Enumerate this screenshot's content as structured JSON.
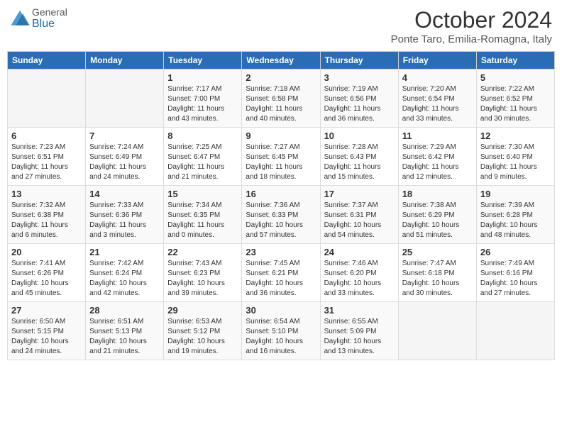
{
  "header": {
    "logo_general": "General",
    "logo_blue": "Blue",
    "month": "October 2024",
    "location": "Ponte Taro, Emilia-Romagna, Italy"
  },
  "weekdays": [
    "Sunday",
    "Monday",
    "Tuesday",
    "Wednesday",
    "Thursday",
    "Friday",
    "Saturday"
  ],
  "weeks": [
    [
      {
        "day": "",
        "sunrise": "",
        "sunset": "",
        "daylight": ""
      },
      {
        "day": "",
        "sunrise": "",
        "sunset": "",
        "daylight": ""
      },
      {
        "day": "1",
        "sunrise": "Sunrise: 7:17 AM",
        "sunset": "Sunset: 7:00 PM",
        "daylight": "Daylight: 11 hours and 43 minutes."
      },
      {
        "day": "2",
        "sunrise": "Sunrise: 7:18 AM",
        "sunset": "Sunset: 6:58 PM",
        "daylight": "Daylight: 11 hours and 40 minutes."
      },
      {
        "day": "3",
        "sunrise": "Sunrise: 7:19 AM",
        "sunset": "Sunset: 6:56 PM",
        "daylight": "Daylight: 11 hours and 36 minutes."
      },
      {
        "day": "4",
        "sunrise": "Sunrise: 7:20 AM",
        "sunset": "Sunset: 6:54 PM",
        "daylight": "Daylight: 11 hours and 33 minutes."
      },
      {
        "day": "5",
        "sunrise": "Sunrise: 7:22 AM",
        "sunset": "Sunset: 6:52 PM",
        "daylight": "Daylight: 11 hours and 30 minutes."
      }
    ],
    [
      {
        "day": "6",
        "sunrise": "Sunrise: 7:23 AM",
        "sunset": "Sunset: 6:51 PM",
        "daylight": "Daylight: 11 hours and 27 minutes."
      },
      {
        "day": "7",
        "sunrise": "Sunrise: 7:24 AM",
        "sunset": "Sunset: 6:49 PM",
        "daylight": "Daylight: 11 hours and 24 minutes."
      },
      {
        "day": "8",
        "sunrise": "Sunrise: 7:25 AM",
        "sunset": "Sunset: 6:47 PM",
        "daylight": "Daylight: 11 hours and 21 minutes."
      },
      {
        "day": "9",
        "sunrise": "Sunrise: 7:27 AM",
        "sunset": "Sunset: 6:45 PM",
        "daylight": "Daylight: 11 hours and 18 minutes."
      },
      {
        "day": "10",
        "sunrise": "Sunrise: 7:28 AM",
        "sunset": "Sunset: 6:43 PM",
        "daylight": "Daylight: 11 hours and 15 minutes."
      },
      {
        "day": "11",
        "sunrise": "Sunrise: 7:29 AM",
        "sunset": "Sunset: 6:42 PM",
        "daylight": "Daylight: 11 hours and 12 minutes."
      },
      {
        "day": "12",
        "sunrise": "Sunrise: 7:30 AM",
        "sunset": "Sunset: 6:40 PM",
        "daylight": "Daylight: 11 hours and 9 minutes."
      }
    ],
    [
      {
        "day": "13",
        "sunrise": "Sunrise: 7:32 AM",
        "sunset": "Sunset: 6:38 PM",
        "daylight": "Daylight: 11 hours and 6 minutes."
      },
      {
        "day": "14",
        "sunrise": "Sunrise: 7:33 AM",
        "sunset": "Sunset: 6:36 PM",
        "daylight": "Daylight: 11 hours and 3 minutes."
      },
      {
        "day": "15",
        "sunrise": "Sunrise: 7:34 AM",
        "sunset": "Sunset: 6:35 PM",
        "daylight": "Daylight: 11 hours and 0 minutes."
      },
      {
        "day": "16",
        "sunrise": "Sunrise: 7:36 AM",
        "sunset": "Sunset: 6:33 PM",
        "daylight": "Daylight: 10 hours and 57 minutes."
      },
      {
        "day": "17",
        "sunrise": "Sunrise: 7:37 AM",
        "sunset": "Sunset: 6:31 PM",
        "daylight": "Daylight: 10 hours and 54 minutes."
      },
      {
        "day": "18",
        "sunrise": "Sunrise: 7:38 AM",
        "sunset": "Sunset: 6:29 PM",
        "daylight": "Daylight: 10 hours and 51 minutes."
      },
      {
        "day": "19",
        "sunrise": "Sunrise: 7:39 AM",
        "sunset": "Sunset: 6:28 PM",
        "daylight": "Daylight: 10 hours and 48 minutes."
      }
    ],
    [
      {
        "day": "20",
        "sunrise": "Sunrise: 7:41 AM",
        "sunset": "Sunset: 6:26 PM",
        "daylight": "Daylight: 10 hours and 45 minutes."
      },
      {
        "day": "21",
        "sunrise": "Sunrise: 7:42 AM",
        "sunset": "Sunset: 6:24 PM",
        "daylight": "Daylight: 10 hours and 42 minutes."
      },
      {
        "day": "22",
        "sunrise": "Sunrise: 7:43 AM",
        "sunset": "Sunset: 6:23 PM",
        "daylight": "Daylight: 10 hours and 39 minutes."
      },
      {
        "day": "23",
        "sunrise": "Sunrise: 7:45 AM",
        "sunset": "Sunset: 6:21 PM",
        "daylight": "Daylight: 10 hours and 36 minutes."
      },
      {
        "day": "24",
        "sunrise": "Sunrise: 7:46 AM",
        "sunset": "Sunset: 6:20 PM",
        "daylight": "Daylight: 10 hours and 33 minutes."
      },
      {
        "day": "25",
        "sunrise": "Sunrise: 7:47 AM",
        "sunset": "Sunset: 6:18 PM",
        "daylight": "Daylight: 10 hours and 30 minutes."
      },
      {
        "day": "26",
        "sunrise": "Sunrise: 7:49 AM",
        "sunset": "Sunset: 6:16 PM",
        "daylight": "Daylight: 10 hours and 27 minutes."
      }
    ],
    [
      {
        "day": "27",
        "sunrise": "Sunrise: 6:50 AM",
        "sunset": "Sunset: 5:15 PM",
        "daylight": "Daylight: 10 hours and 24 minutes."
      },
      {
        "day": "28",
        "sunrise": "Sunrise: 6:51 AM",
        "sunset": "Sunset: 5:13 PM",
        "daylight": "Daylight: 10 hours and 21 minutes."
      },
      {
        "day": "29",
        "sunrise": "Sunrise: 6:53 AM",
        "sunset": "Sunset: 5:12 PM",
        "daylight": "Daylight: 10 hours and 19 minutes."
      },
      {
        "day": "30",
        "sunrise": "Sunrise: 6:54 AM",
        "sunset": "Sunset: 5:10 PM",
        "daylight": "Daylight: 10 hours and 16 minutes."
      },
      {
        "day": "31",
        "sunrise": "Sunrise: 6:55 AM",
        "sunset": "Sunset: 5:09 PM",
        "daylight": "Daylight: 10 hours and 13 minutes."
      },
      {
        "day": "",
        "sunrise": "",
        "sunset": "",
        "daylight": ""
      },
      {
        "day": "",
        "sunrise": "",
        "sunset": "",
        "daylight": ""
      }
    ]
  ]
}
